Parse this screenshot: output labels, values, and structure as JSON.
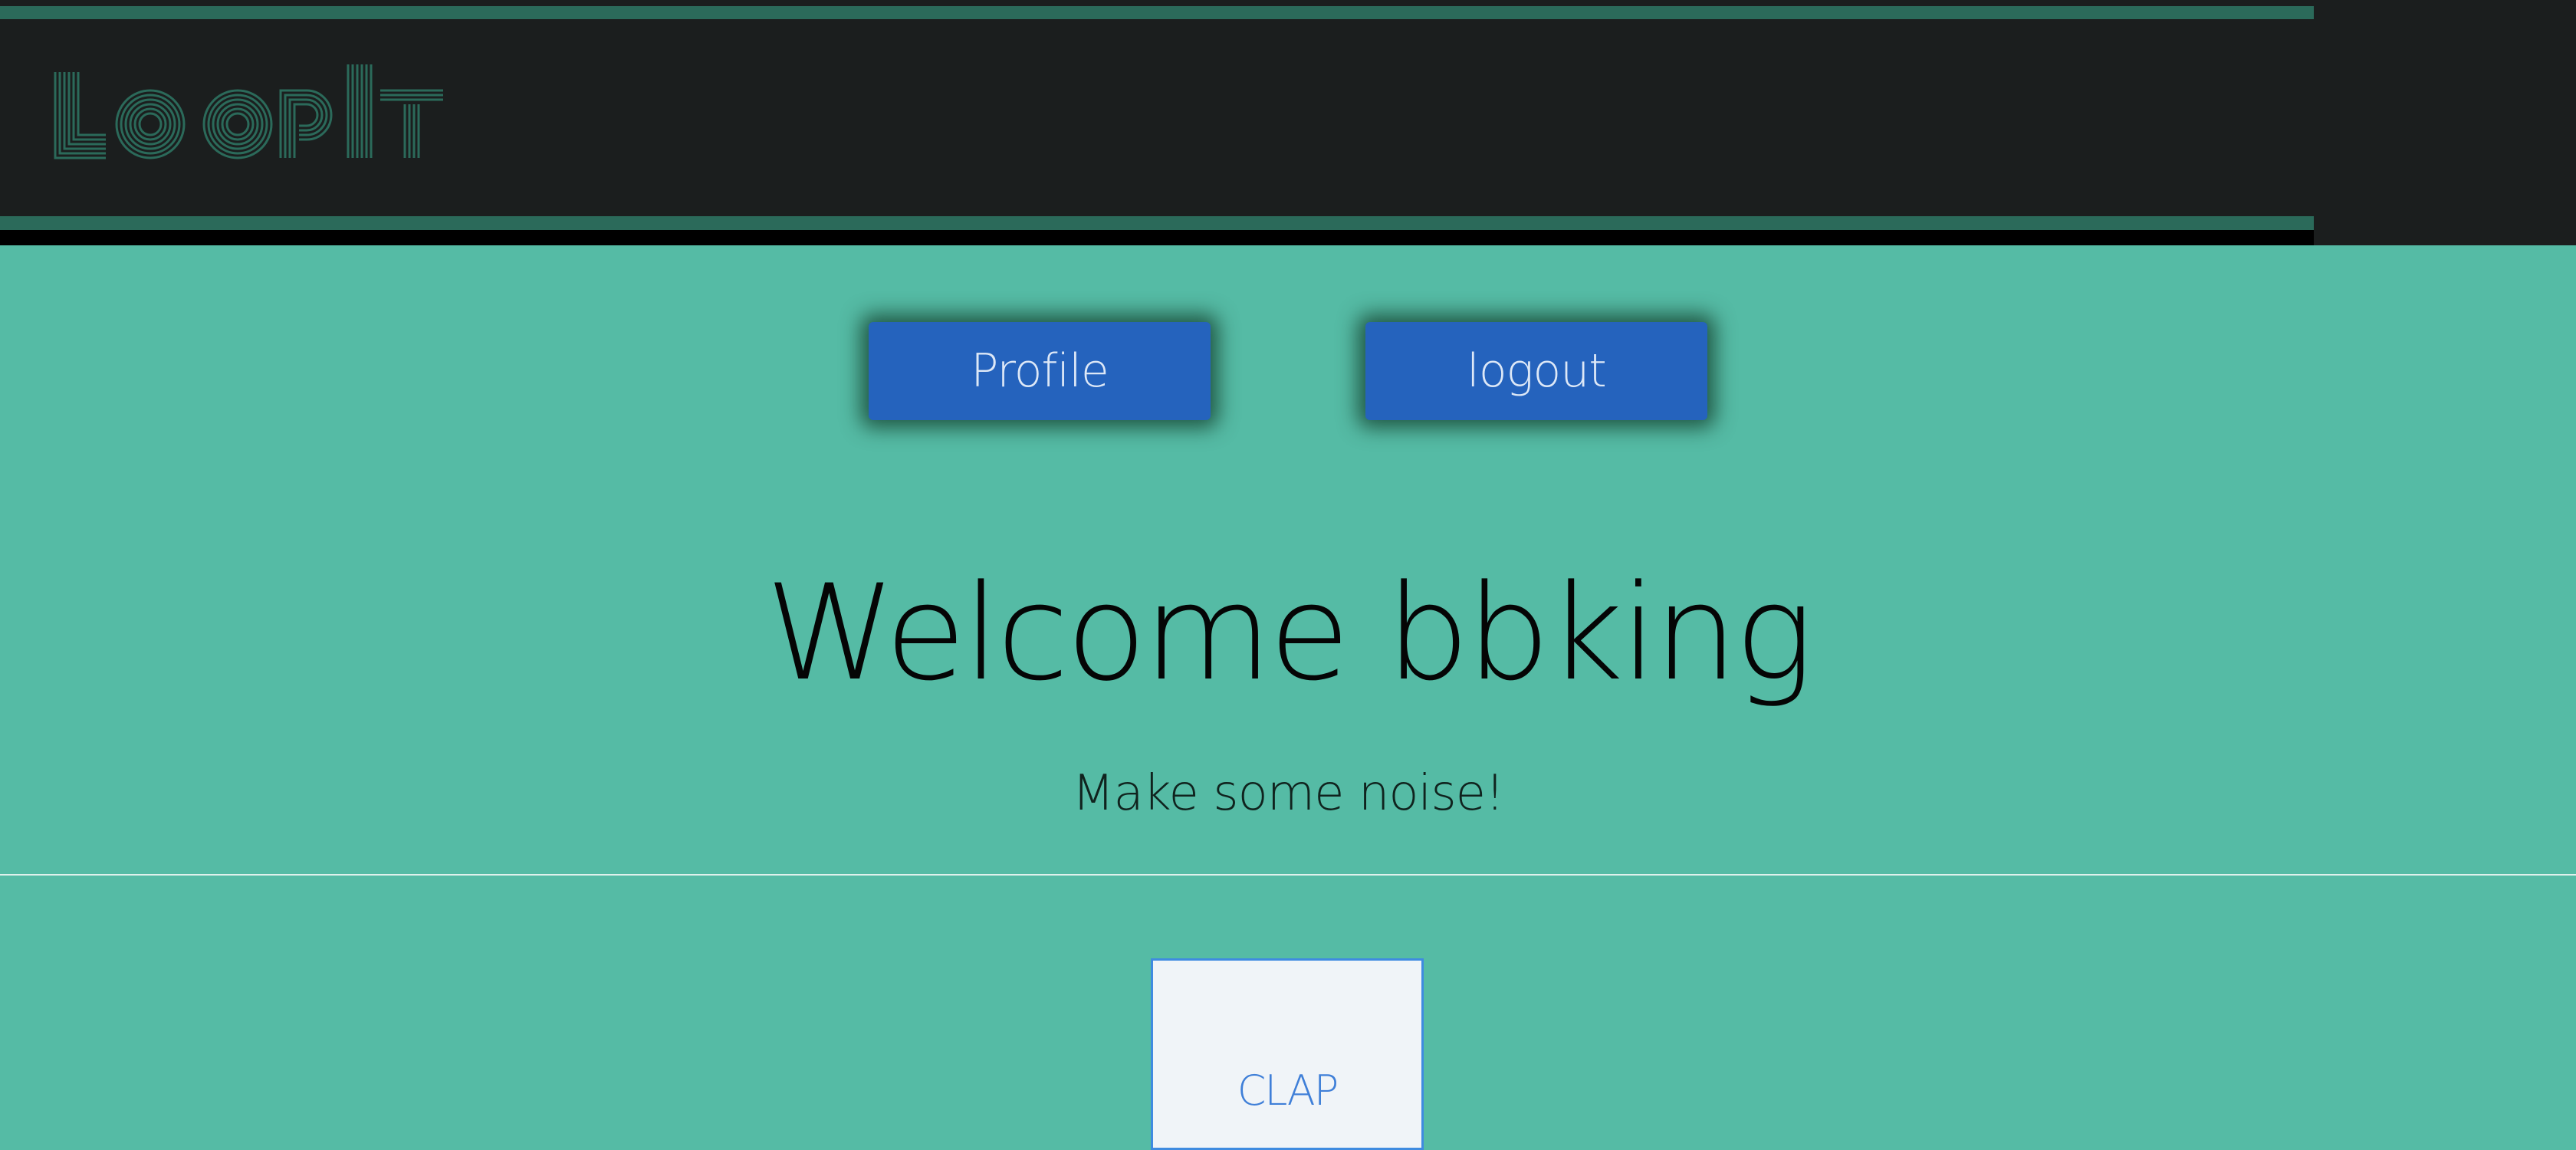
{
  "header": {
    "logo_text": "LOOPIT"
  },
  "nav": {
    "profile_label": "Profile",
    "logout_label": "logout"
  },
  "main": {
    "welcome_text": "Welcome bbking",
    "tagline": "Make some noise!"
  },
  "pads": [
    {
      "label": "CLAP"
    }
  ],
  "colors": {
    "background": "#55bba5",
    "header": "#1b1e1e",
    "header_band": "#2b6a5a",
    "button": "#2563bd",
    "logo": "#2b6a5a",
    "pad_border": "#3f8be0"
  }
}
